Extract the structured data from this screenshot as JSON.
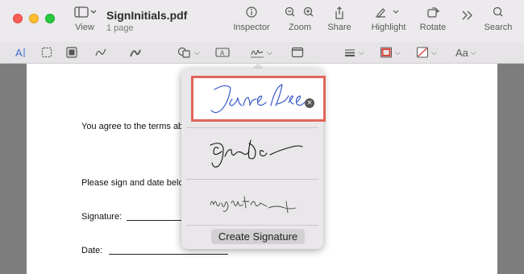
{
  "window": {
    "title": "SignInitials.pdf",
    "subtitle": "1 page"
  },
  "toolbar": {
    "view_label": "View",
    "inspector_label": "Inspector",
    "zoom_label": "Zoom",
    "share_label": "Share",
    "highlight_label": "Highlight",
    "rotate_label": "Rotate",
    "search_label": "Search"
  },
  "markup_bar": {
    "text_style_label": "Aa"
  },
  "document": {
    "line1": "You agree to the terms abo",
    "line2": "Please sign and date below",
    "signature_label": "Signature:",
    "date_label": "Date:"
  },
  "signature_popover": {
    "signatures": [
      {
        "name": "signature-jane-doe-typed",
        "selected": true
      },
      {
        "name": "signature-jane-doe-handwritten",
        "selected": false
      },
      {
        "name": "signature-my-signature",
        "selected": false
      }
    ],
    "create_button_label": "Create Signature",
    "remove_icon": "×"
  },
  "colors": {
    "accent": "#3b6bd6",
    "selection_border": "#e0665a",
    "signature_ink_blue": "#3c5bc9",
    "traffic_red": "#fe5f57",
    "traffic_yellow": "#febc2e",
    "traffic_green": "#28c840"
  }
}
